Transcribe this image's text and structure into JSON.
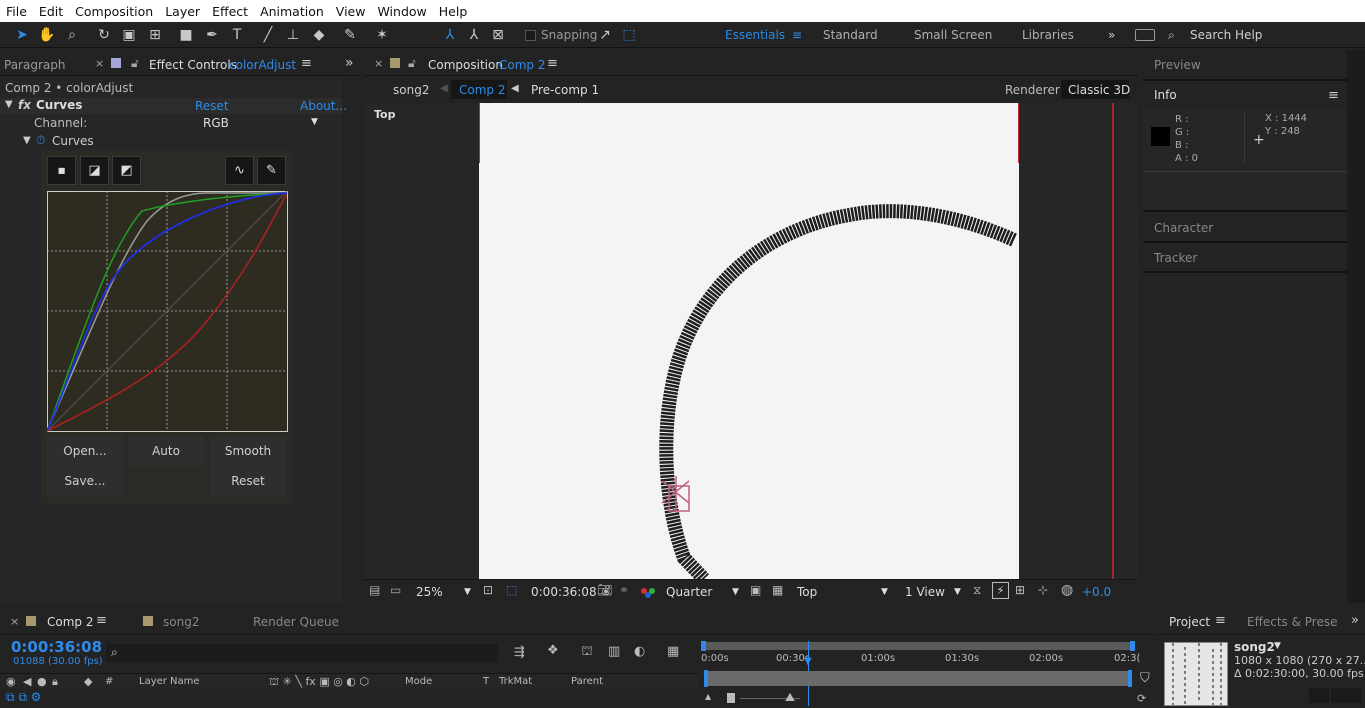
{
  "menu": [
    "File",
    "Edit",
    "Composition",
    "Layer",
    "Effect",
    "Animation",
    "View",
    "Window",
    "Help"
  ],
  "toolbar": {
    "snapping": "Snapping"
  },
  "workspaces": [
    "Essentials",
    "Standard",
    "Small Screen",
    "Libraries"
  ],
  "search_help": "Search Help",
  "left_panel": {
    "tab_paragraph": "Paragraph",
    "tab_effect_controls": "Effect Controls",
    "tab_layer": "colorAdjust",
    "breadcrumb": "Comp 2 • colorAdjust",
    "effect_name": "Curves",
    "reset": "Reset",
    "about": "About...",
    "channel_label": "Channel:",
    "channel_value": "RGB",
    "curves_label": "Curves",
    "buttons": {
      "open": "Open...",
      "auto": "Auto",
      "smooth": "Smooth",
      "save": "Save...",
      "reset": "Reset"
    }
  },
  "curves_chart": {
    "colors": {
      "red": "#b02020",
      "green": "#20a020",
      "blue": "#2030e0",
      "gray": "#999999",
      "diag": "#555555"
    },
    "grid": "dashed"
  },
  "composition": {
    "tab_label": "Composition",
    "tab_comp": "Comp 2",
    "crumbs": [
      "song2",
      "Comp 2",
      "Pre-comp 1"
    ],
    "renderer_label": "Renderer:",
    "renderer_value": "Classic 3D",
    "view_label": "Top",
    "zoom": "25%",
    "timecode": "0:00:36:08",
    "resolution": "Quarter",
    "camera": "Top",
    "views": "1 View",
    "exposure": "+0.0"
  },
  "right_panel": {
    "preview": "Preview",
    "info": "Info",
    "r": "R :",
    "g": "G :",
    "b": "B :",
    "a": "A :  0",
    "x": "X : 1444",
    "y": "Y : 248",
    "character": "Character",
    "tracker": "Tracker"
  },
  "timeline": {
    "tabs": [
      "Comp 2",
      "song2",
      "Render Queue"
    ],
    "timecode": "0:00:36:08",
    "fps": "01088 (30.00 fps)",
    "ruler": [
      "0:00s",
      "00:30s",
      "01:00s",
      "01:30s",
      "02:00s",
      "02:3("
    ],
    "columns": {
      "layer_name": "Layer Name",
      "mode": "Mode",
      "t": "T",
      "trkmat": "TrkMat",
      "parent": "Parent",
      "hash": "#"
    }
  },
  "project": {
    "tab_project": "Project",
    "tab_effects": "Effects & Prese",
    "item_name": "song2",
    "item_dims": "1080 x 1080  (270 x 27...",
    "item_duration": "Δ 0:02:30:00, 30.00 fps"
  }
}
